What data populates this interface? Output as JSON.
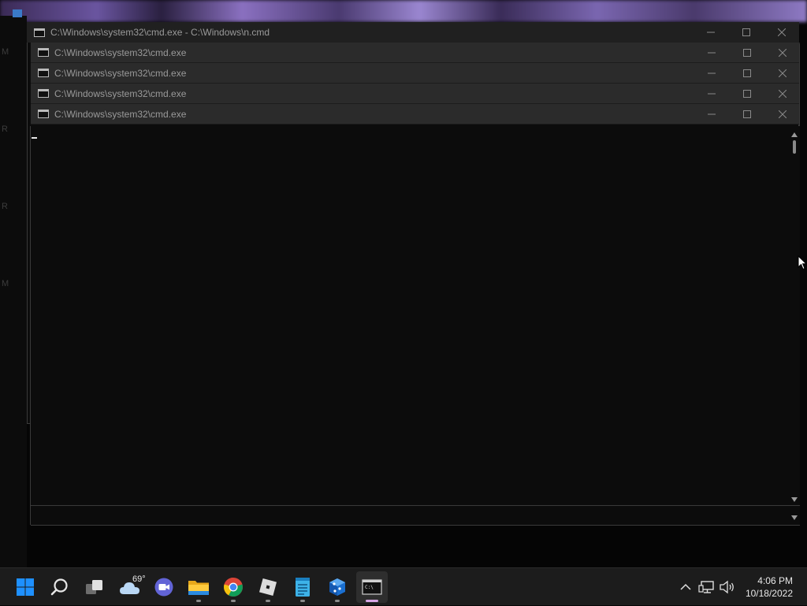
{
  "back_window": {
    "title": "C:\\Windows\\system32\\cmd.exe - C:\\Windows\\n.cmd"
  },
  "stacked_windows": [
    {
      "title": "C:\\Windows\\system32\\cmd.exe"
    },
    {
      "title": "C:\\Windows\\system32\\cmd.exe"
    },
    {
      "title": "C:\\Windows\\system32\\cmd.exe"
    },
    {
      "title": "C:\\Windows\\system32\\cmd.exe"
    }
  ],
  "window_controls": {
    "minimize_icon": "minimize-icon",
    "maximize_icon": "maximize-icon",
    "close_icon": "close-icon",
    "cmd_icon_text": "C:\\"
  },
  "taskbar": {
    "apps": [
      {
        "name": "start-button",
        "icon": "windows-logo-icon"
      },
      {
        "name": "search-button",
        "icon": "search-icon"
      },
      {
        "name": "task-view-button",
        "icon": "task-view-icon"
      },
      {
        "name": "widgets-button",
        "icon": "weather-cloud-icon"
      },
      {
        "name": "teams-chat-button",
        "icon": "video-chat-icon"
      },
      {
        "name": "file-explorer-button",
        "icon": "folder-icon"
      },
      {
        "name": "chrome-button",
        "icon": "chrome-icon"
      },
      {
        "name": "roblox-button",
        "icon": "roblox-icon"
      },
      {
        "name": "notepad-button",
        "icon": "notepad-icon"
      },
      {
        "name": "app-button",
        "icon": "blue-app-icon"
      },
      {
        "name": "cmd-button",
        "icon": "terminal-icon"
      }
    ],
    "weather_temp": "69°",
    "clock_time": "4:06 PM",
    "clock_date": "10/18/2022"
  },
  "colors": {
    "console_bg": "#0c0c0c",
    "titlebar_bg": "#2b2b2b",
    "taskbar_bg": "#1c1c1c",
    "accent_active": "#d7a6e6",
    "windows_blue": "#1e90ff"
  }
}
